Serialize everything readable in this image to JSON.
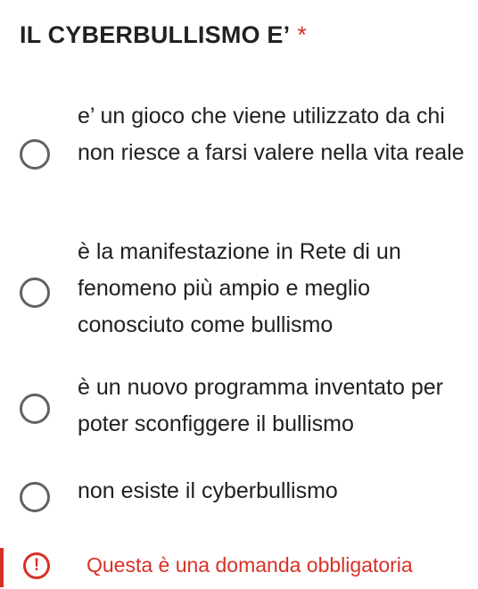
{
  "question": {
    "title": "IL CYBERBULLISMO E’",
    "required_marker": "*"
  },
  "options": [
    {
      "label": "e’ un gioco che viene utilizzato da chi non riesce a farsi valere nella vita reale",
      "selected": false
    },
    {
      "label": "è la manifestazione in Rete di un fenomeno più ampio e meglio conosciuto come bullismo",
      "selected": false
    },
    {
      "label": "è un nuovo programma inventato per poter sconfiggere il bullismo",
      "selected": false
    },
    {
      "label": "non esiste il cyberbullismo",
      "selected": false
    }
  ],
  "error": {
    "icon": "exclamation-icon",
    "icon_glyph": "!",
    "message": "Questa è una domanda obbligatoria"
  },
  "colors": {
    "text": "#202124",
    "radio_border": "#5f6368",
    "error": "#d93025"
  }
}
